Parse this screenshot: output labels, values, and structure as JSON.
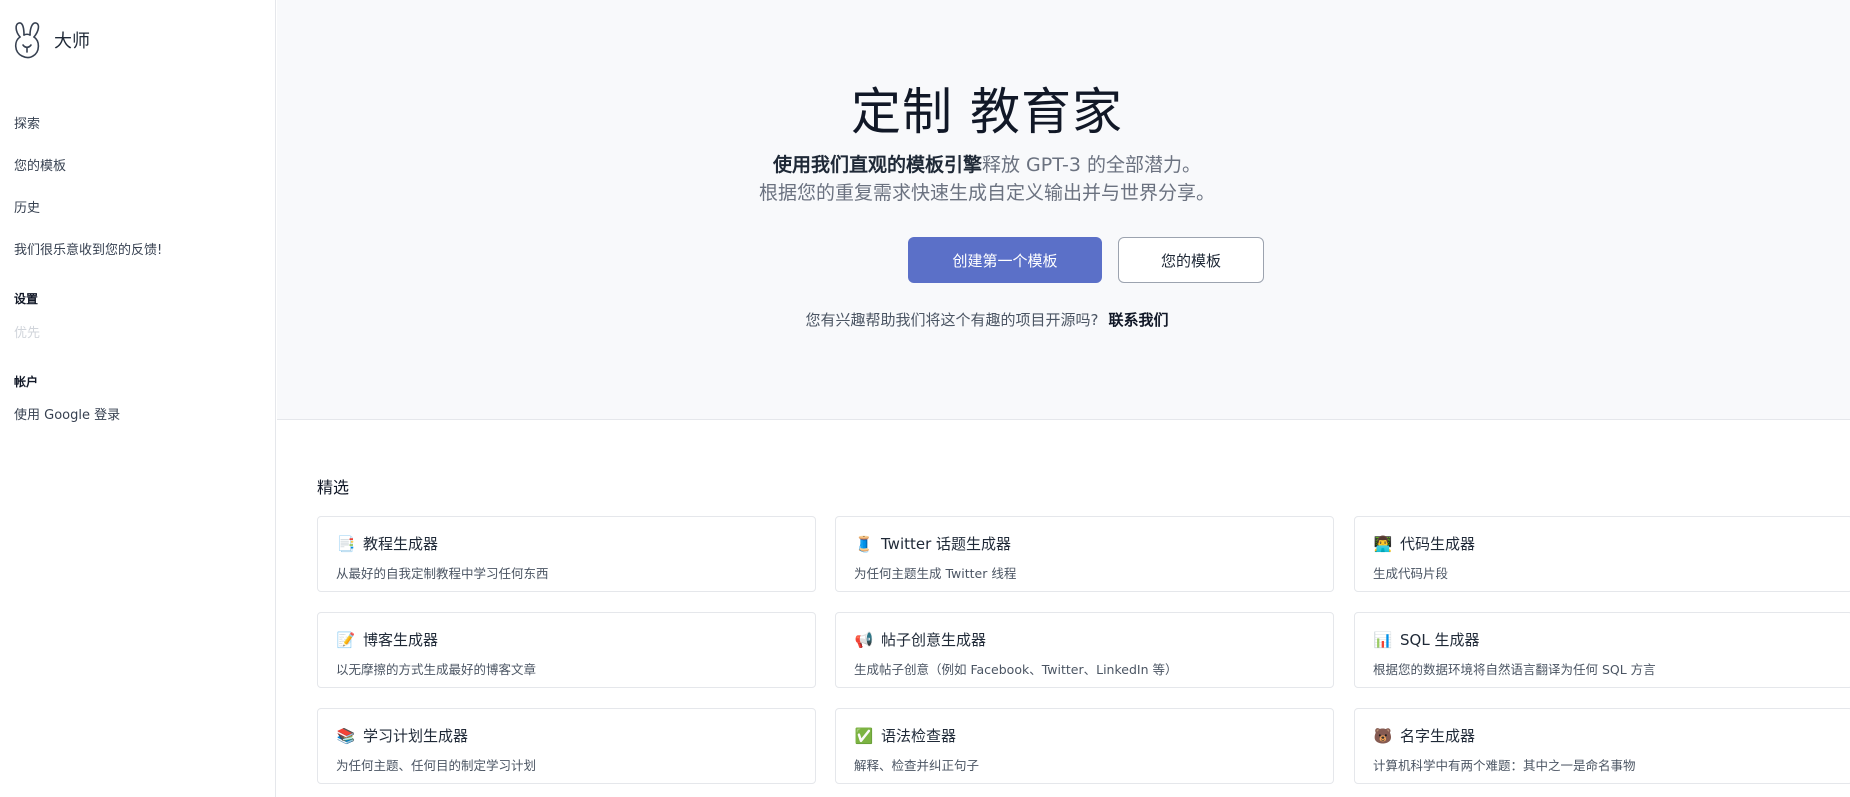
{
  "sidebar": {
    "brand_name": "大师",
    "logo_icon": "rabbit-logo-icon",
    "nav": {
      "explore": "探索",
      "your_templates": "您的模板",
      "history": "历史",
      "feedback": "我们很乐意收到您的反馈!"
    },
    "settings_title": "设置",
    "preferences": "优先",
    "account_title": "帐户",
    "login": "使用 Google 登录"
  },
  "hero": {
    "title": "定制 教育家",
    "subtitle_bold": "使用我们直观的模板引擎",
    "subtitle_rest": "释放 GPT-3 的全部潜力。",
    "subtitle_line2": "根据您的重复需求快速生成自定义输出并与世界分享。",
    "primary_button": "创建第一个模板",
    "secondary_button": "您的模板",
    "contact_question": "您有兴趣帮助我们将这个有趣的项目开源吗?",
    "contact_link": "联系我们"
  },
  "featured": {
    "title": "精选",
    "cards": [
      {
        "emoji": "📑",
        "icon": "document-icon",
        "title": "教程生成器",
        "desc": "从最好的自我定制教程中学习任何东西"
      },
      {
        "emoji": "🧵",
        "icon": "thread-spool-icon",
        "title": "Twitter 话题生成器",
        "desc": "为任何主题生成 Twitter 线程"
      },
      {
        "emoji": "👨‍💻",
        "icon": "technologist-icon",
        "title": "代码生成器",
        "desc": "生成代码片段"
      },
      {
        "emoji": "📝",
        "icon": "memo-icon",
        "title": "博客生成器",
        "desc": "以无摩擦的方式生成最好的博客文章"
      },
      {
        "emoji": "📢",
        "icon": "megaphone-icon",
        "title": "帖子创意生成器",
        "desc": "生成帖子创意（例如 Facebook、Twitter、LinkedIn 等）"
      },
      {
        "emoji": "📊",
        "icon": "bar-chart-icon",
        "title": "SQL 生成器",
        "desc": "根据您的数据环境将自然语言翻译为任何 SQL 方言"
      },
      {
        "emoji": "📚",
        "icon": "books-icon",
        "title": "学习计划生成器",
        "desc": "为任何主题、任何目的制定学习计划"
      },
      {
        "emoji": "✅",
        "icon": "check-mark-icon",
        "title": "语法检查器",
        "desc": "解释、检查并纠正句子"
      },
      {
        "emoji": "🐻",
        "icon": "bear-face-icon",
        "title": "名字生成器",
        "desc": "计算机科学中有两个难题：其中之一是命名事物"
      }
    ]
  },
  "colors": {
    "primary_button": "#5b70c8",
    "hero_background": "#f8f9fb",
    "border": "#e5e7eb"
  }
}
